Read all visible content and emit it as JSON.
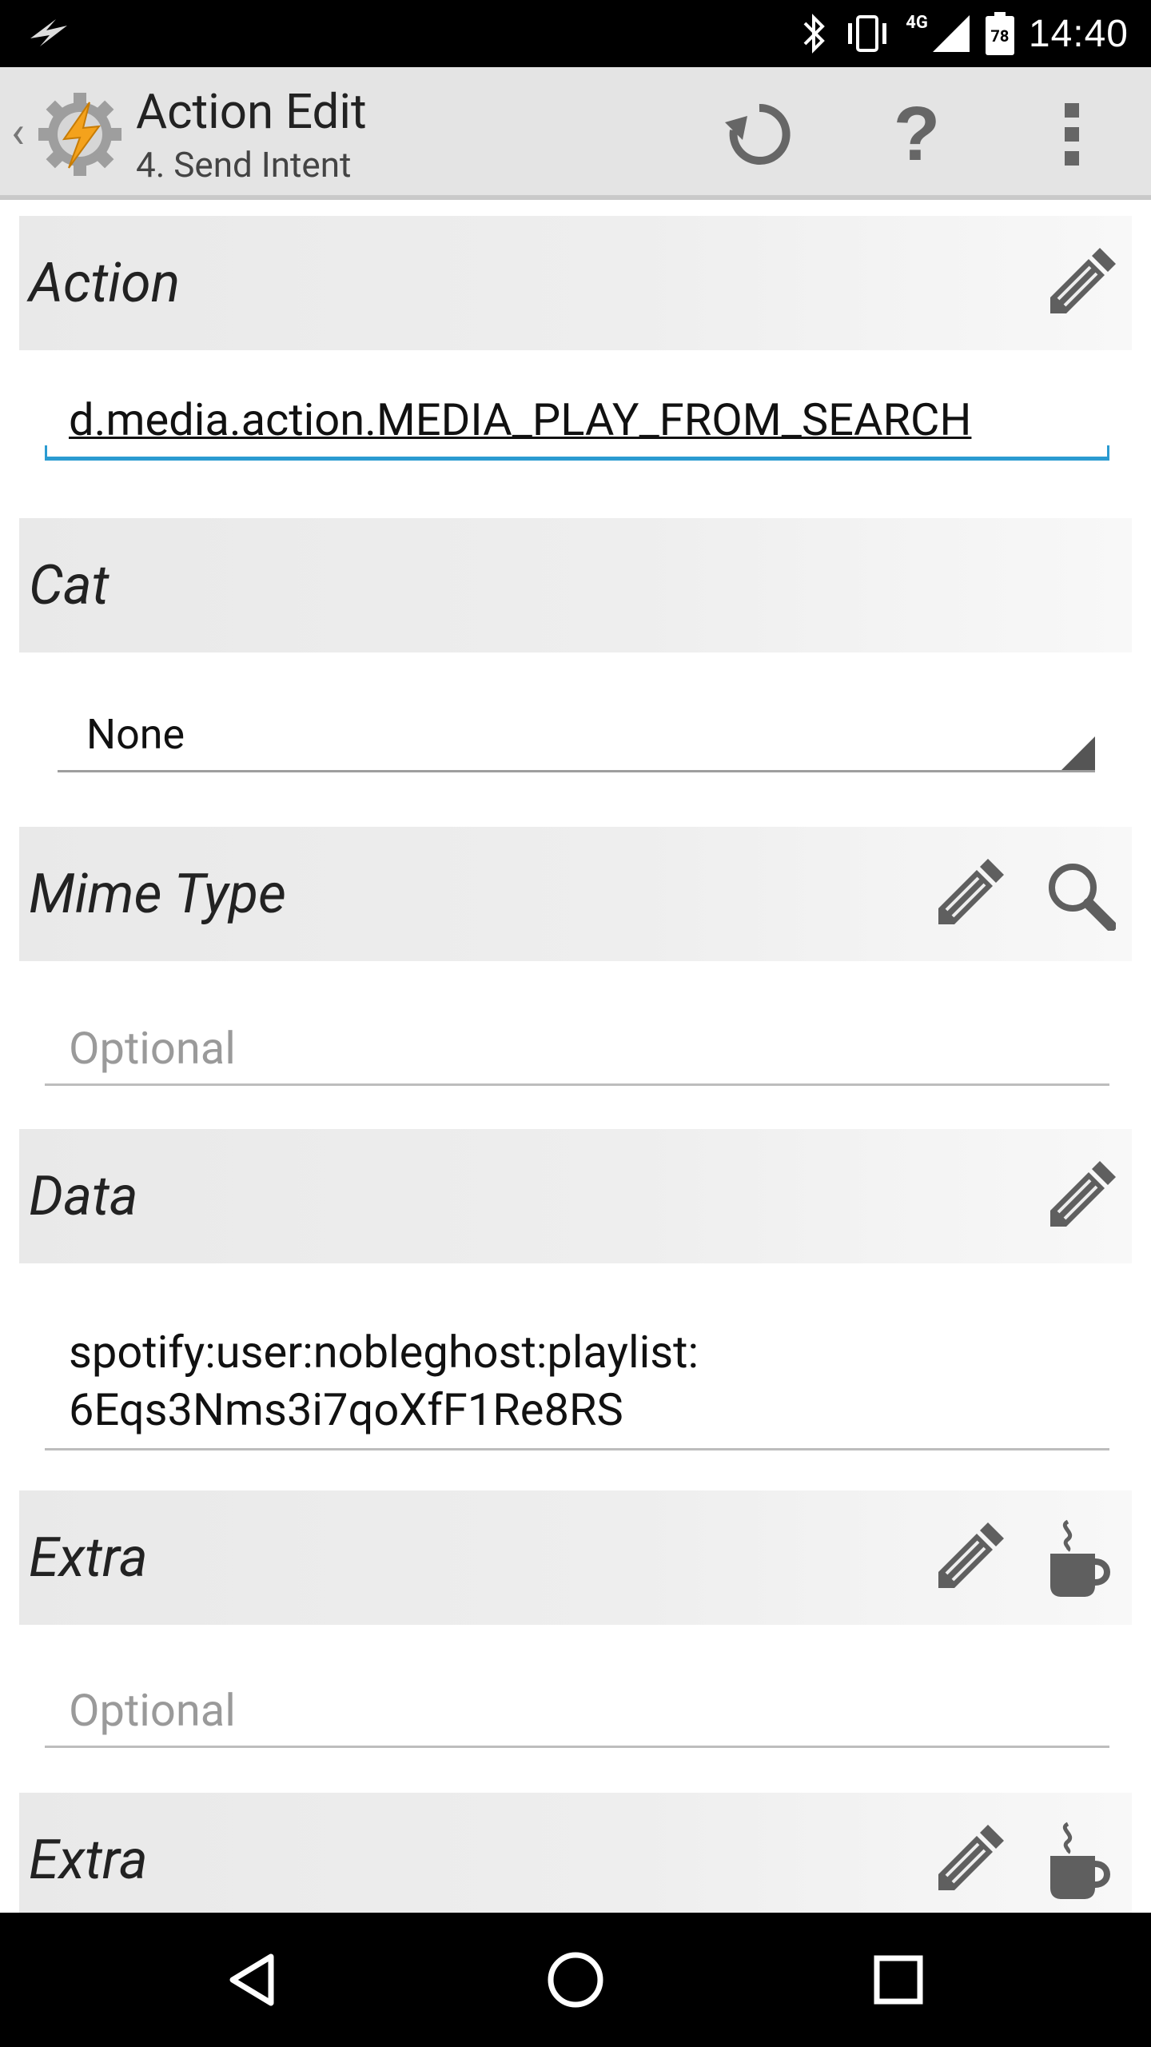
{
  "status_bar": {
    "time": "14:40",
    "network": "4G",
    "battery": "78",
    "icons": [
      "flash-icon",
      "bluetooth-icon",
      "vibrate-icon",
      "signal-icon",
      "battery-icon"
    ]
  },
  "app_bar": {
    "title": "Action Edit",
    "subtitle": "4. Send Intent",
    "actions": [
      "undo-icon",
      "help-icon",
      "overflow-menu-icon"
    ]
  },
  "sections": {
    "action": {
      "label": "Action",
      "value": "d.media.action.MEDIA_PLAY_FROM_SEARCH"
    },
    "cat": {
      "label": "Cat",
      "selected": "None"
    },
    "mime_type": {
      "label": "Mime Type",
      "placeholder": "Optional"
    },
    "data": {
      "label": "Data",
      "value_line1": "spotify:user:nobleghost:playlist:",
      "value_line2": "6Eqs3Nms3i7qoXfF1Re8RS"
    },
    "extra1": {
      "label": "Extra",
      "placeholder": "Optional"
    },
    "extra2": {
      "label": "Extra"
    }
  },
  "nav_bar": {
    "buttons": [
      "back-icon",
      "home-icon",
      "recents-icon"
    ]
  },
  "colors": {
    "accent": "#2b9bd1",
    "section_bg": "#eeeeee",
    "icon_gray": "#5f5f5f"
  }
}
